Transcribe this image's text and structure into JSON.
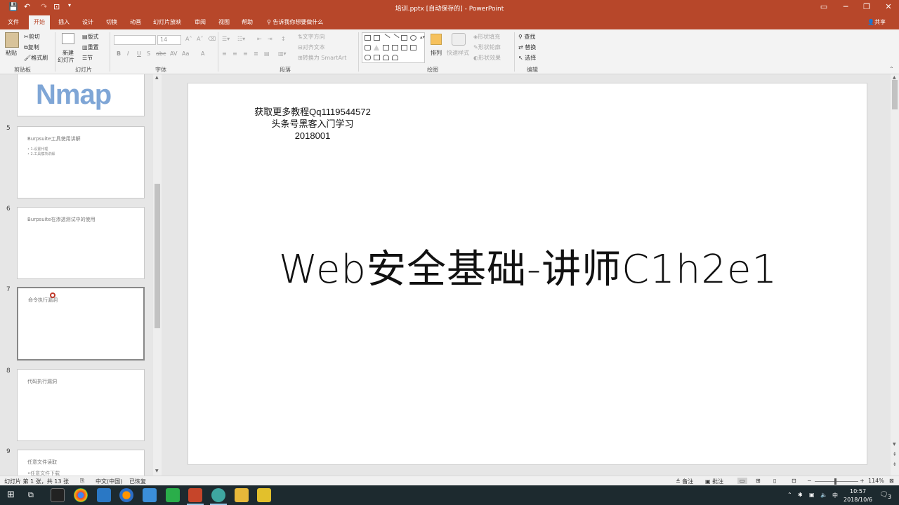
{
  "window": {
    "title": "培训.pptx [自动保存的]  -  PowerPoint",
    "controls": {
      "ribbon_display": "▭",
      "minimize": "─",
      "restore": "❐",
      "close": "✕"
    }
  },
  "tabs": [
    "文件",
    "开始",
    "插入",
    "设计",
    "切换",
    "动画",
    "幻灯片放映",
    "审阅",
    "视图",
    "帮助"
  ],
  "active_tab": "开始",
  "tell_me": "告诉我你想要做什么",
  "share": "共享",
  "ribbon": {
    "clipboard": {
      "label": "剪贴板",
      "paste": "粘贴",
      "cut": "剪切",
      "copy": "复制",
      "format_painter": "格式刷"
    },
    "slides": {
      "label": "幻灯片",
      "new_slide": "新建",
      "new_slide2": "幻灯片",
      "layout": "版式",
      "reset": "重置",
      "section": "节"
    },
    "font": {
      "label": "字体",
      "font_name": "",
      "font_size": "14"
    },
    "paragraph": {
      "label": "段落",
      "text_direction": "文字方向",
      "align_text": "对齐文本",
      "smartart": "转换为 SmartArt"
    },
    "drawing": {
      "label": "绘图",
      "arrange": "排列",
      "quick_styles": "快速样式",
      "shape_fill": "形状填充",
      "shape_outline": "形状轮廓",
      "shape_effects": "形状效果"
    },
    "editing": {
      "label": "编辑",
      "find": "查找",
      "replace": "替换",
      "select": "选择"
    }
  },
  "thumbnails": [
    {
      "num": "5",
      "title": "Burpsuite工具使用讲解",
      "bullets": [
        "• 1.设置代理",
        "• 2.工具模块讲解"
      ]
    },
    {
      "num": "6",
      "title": "Burpsuite在渗透测试中的使用",
      "bullets": []
    },
    {
      "num": "7",
      "title": "命令执行漏洞",
      "bullets": []
    },
    {
      "num": "8",
      "title": "代码执行漏洞",
      "bullets": []
    },
    {
      "num": "9",
      "title": "任意文件读取",
      "bullets": [
        "•任意文件下载"
      ]
    }
  ],
  "thumb_top_logo": "Nmap",
  "slide": {
    "watermark_lines": [
      "获取更多教程Qq1119544572",
      "头条号黑客入门学习",
      "2018001"
    ],
    "title": "Web安全基础-讲师C1h2e1"
  },
  "status": {
    "slide_info": "幻灯片 第 1 张，共 13 张",
    "language": "中文(中国)",
    "recovered": "已恢复",
    "notes": "备注",
    "comments": "批注",
    "zoom": "114%"
  },
  "taskbar": {
    "time": "10:57",
    "date": "2018/10/6",
    "ime": "中",
    "notifications": "3"
  },
  "colors": {
    "accent": "#b7472a",
    "taskbar": "#1d2a2f"
  }
}
